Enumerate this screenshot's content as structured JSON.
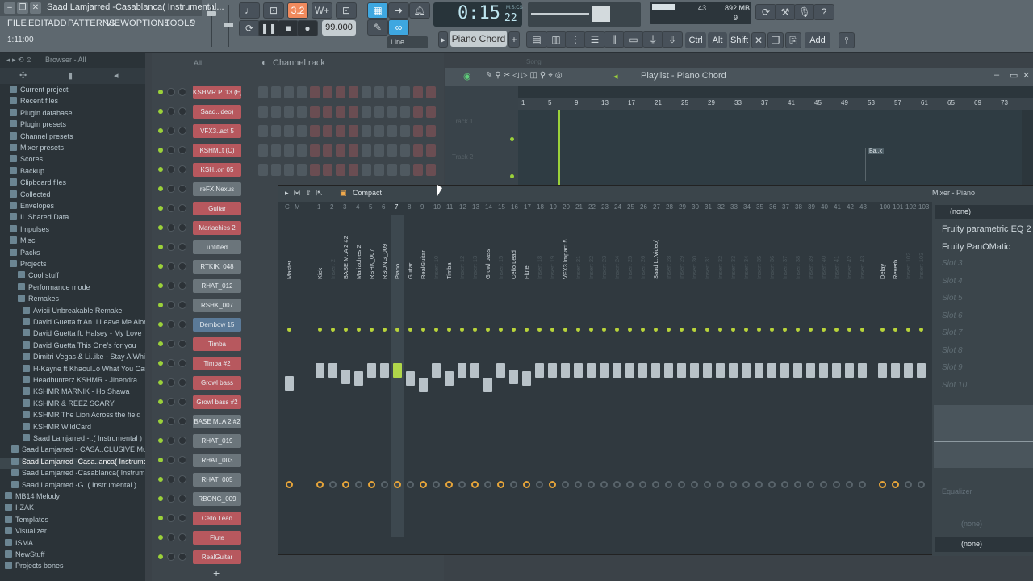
{
  "window": {
    "title": "Saad Lamjarred -Casablanca( Instrumental..."
  },
  "menu": [
    "FILE",
    "EDIT",
    "ADD",
    "PATTERNS",
    "VIEW",
    "OPTIONS",
    "TOOLS",
    "?"
  ],
  "hint": "1:11:00",
  "transport": {
    "pattern_label": "3.2",
    "tempo": "99.000",
    "time": "0:15",
    "time_sub": "22",
    "time_unit": "M:S:CS",
    "snap": "Line",
    "pattern": "Piano Chord",
    "add_pattern": "+"
  },
  "cpu": {
    "cpu": "43",
    "ram": "892 MB",
    "poly": "9"
  },
  "hotkeys": [
    "Ctrl",
    "Alt",
    "Shift",
    "Add"
  ],
  "browser": {
    "title": "Browser - All",
    "items": [
      "Current project",
      "Recent files",
      "Plugin database",
      "Plugin presets",
      "Channel presets",
      "Mixer presets",
      "Scores",
      "Backup",
      "Clipboard files",
      "Collected",
      "Envelopes",
      "IL Shared Data",
      "Impulses",
      "Misc",
      "Packs",
      "Projects",
      "Cool stuff",
      "Performance mode",
      "Remakes",
      "Avicii Unbreakable Remake",
      "David Guetta ft An..l Leave Me Alone",
      "David Guetta ft. Halsey - My Love",
      "David Guetta This One's for you",
      "Dimitri Vegas & Li..ike - Stay A While",
      "H-Kayne ft Khaoul..o What You Can't",
      "Headhunterz KSHMR - Jinendra",
      "KSHMR MARNIK - Ho Shawa",
      "KSHMR & REEZ SCARY",
      "KSHMR The Lion Across the field",
      "KSHMR WildCard",
      "Saad Lamjarred -..( Instrumental )",
      "Saad Lamjarred - CASA..CLUSIVE Music Video)",
      "Saad Lamjarred -Casa..anca( Instrumental )",
      "Saad Lamjarred -Casablanca( Instrumental )",
      "Saad Lamjarred -G..( Instrumental )",
      "MB14 Melody",
      "I-ZAK",
      "Templates",
      "Visualizer",
      "ISMA",
      "NewStuff",
      "Projects bones"
    ]
  },
  "channel_rack": {
    "title": "Channel rack",
    "filter": "All",
    "channels": [
      "KSHMR P..13 (E)",
      "Saad..ideo)",
      "VFX3..act 5",
      "KSHM..t (C)",
      "KSH..on 05",
      "reFX Nexus",
      "Guitar",
      "Mariachies 2",
      "untitled",
      "RTKIK_048",
      "RHAT_012",
      "RSHK_007",
      "Dembow 15",
      "Timba",
      "Timba #2",
      "Growl bass",
      "Growl bass #2",
      "BASE M..A 2 #2",
      "RHAT_019",
      "RHAT_003",
      "RHAT_005",
      "RBONG_009",
      "Cello Lead",
      "Flute",
      "RealGuitar"
    ]
  },
  "playlist": {
    "title": "Playlist - Piano Chord",
    "ruler": [
      "1",
      "5",
      "9",
      "13",
      "17",
      "21",
      "25",
      "29",
      "33",
      "37",
      "41",
      "45",
      "49",
      "53",
      "57",
      "61",
      "65",
      "69",
      "73"
    ],
    "tracks": [
      "Track 1",
      "Track 2"
    ],
    "clip": "Ba..k",
    "song_label": "Song"
  },
  "mixer": {
    "view": "Compact",
    "nums": [
      "C",
      "M",
      "1",
      "2",
      "3",
      "4",
      "5",
      "6",
      "7",
      "8",
      "9",
      "10",
      "11",
      "12",
      "13",
      "14",
      "15",
      "16",
      "17",
      "18",
      "19",
      "20",
      "21",
      "22",
      "23",
      "24",
      "25",
      "26",
      "27",
      "28",
      "29",
      "30",
      "31",
      "32",
      "33",
      "34",
      "35",
      "36",
      "37",
      "38",
      "39",
      "40",
      "41",
      "42",
      "43",
      "100",
      "101",
      "102",
      "103"
    ],
    "tracks": [
      "Master",
      "Kick",
      "Insert 2",
      "BASE M..A 2 #2",
      "Mariachies 2",
      "RSHK_007",
      "RBONG_009",
      "Piano",
      "Guitar",
      "RealGuitar",
      "Insert 10",
      "Timba",
      "Insert 12",
      "Insert 13",
      "Growl bass",
      "Insert 15",
      "Cello Lead",
      "Flute",
      "Insert 18",
      "Insert 19",
      "VFX3 Impact 5",
      "Insert 21",
      "Insert 22",
      "Insert 23",
      "Insert 24",
      "Insert 25",
      "Insert 26",
      "Saad L..Video)",
      "Insert 28",
      "Insert 29",
      "Insert 30",
      "Insert 31",
      "Insert 32",
      "Insert 33",
      "Insert 34",
      "Insert 35",
      "Insert 36",
      "Insert 37",
      "Insert 38",
      "Insert 39",
      "Insert 40",
      "Insert 41",
      "Insert 42",
      "Insert 43",
      "Delay",
      "Reverb",
      "Insert 102",
      "Insert 103"
    ],
    "panel_title": "Mixer - Piano",
    "input": "(none)",
    "slots": [
      "Fruity parametric EQ 2",
      "Fruity PanOMatic",
      "Slot 3",
      "Slot 4",
      "Slot 5",
      "Slot 6",
      "Slot 7",
      "Slot 8",
      "Slot 9",
      "Slot 10"
    ],
    "equalizer": "Equalizer",
    "out_dim": "(none)",
    "output": "(none)"
  }
}
